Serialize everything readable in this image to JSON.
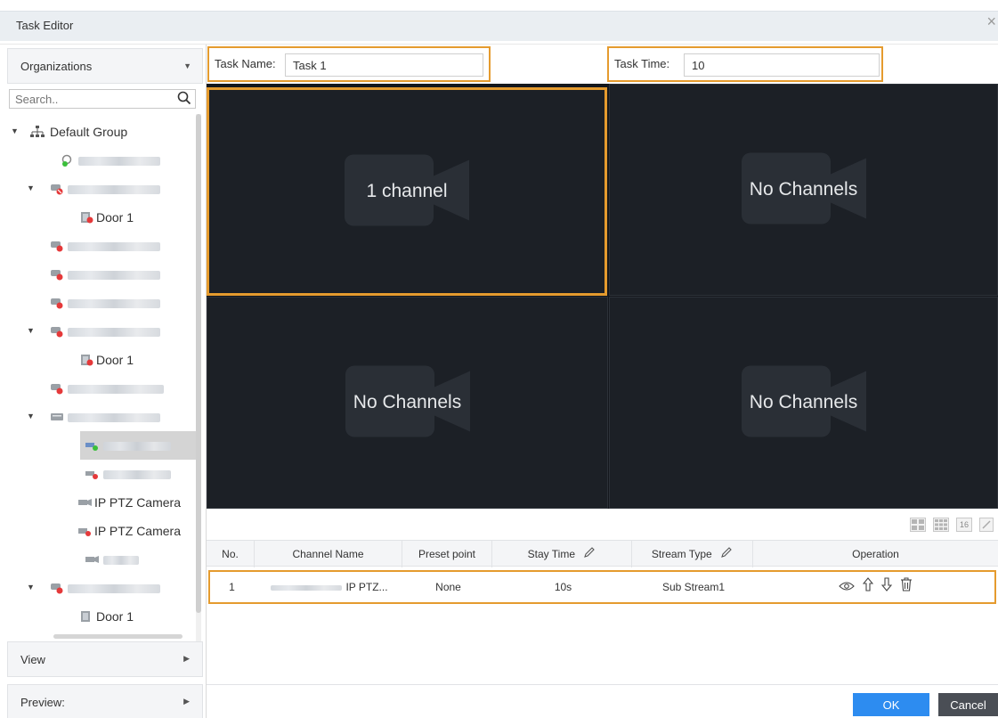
{
  "window": {
    "title": "Task Editor",
    "close_symbol": "×"
  },
  "sidebar": {
    "organizations_label": "Organizations",
    "search_placeholder": "Search..",
    "tree": {
      "root": "Default Group",
      "door_1a": "Door 1",
      "door_1b": "Door 1",
      "ptz_1": "IP PTZ Camera",
      "ptz_2": "IP PTZ Camera",
      "door_1c": "Door 1"
    },
    "view_label": "View",
    "preview_label": "Preview:"
  },
  "task": {
    "name_label": "Task Name:",
    "name_value": "Task 1",
    "time_label": "Task Time:",
    "time_value": "10"
  },
  "grid": {
    "cells": [
      "1 channel",
      "No Channels",
      "No Channels",
      "No Channels"
    ]
  },
  "layout_buttons": {
    "sixteen": "16"
  },
  "table": {
    "headers": {
      "no": "No.",
      "channel_name": "Channel Name",
      "preset_point": "Preset point",
      "stay_time": "Stay Time",
      "stream_type": "Stream Type",
      "operation": "Operation"
    },
    "rows": [
      {
        "no": "1",
        "channel_name": "IP PTZ...",
        "preset_point": "None",
        "stay_time": "10s",
        "stream_type": "Sub Stream1"
      }
    ]
  },
  "footer": {
    "ok": "OK",
    "cancel": "Cancel"
  },
  "colors": {
    "accent_orange": "#e59b2e",
    "primary_blue": "#2d8cf0",
    "grid_bg": "#14171c"
  }
}
